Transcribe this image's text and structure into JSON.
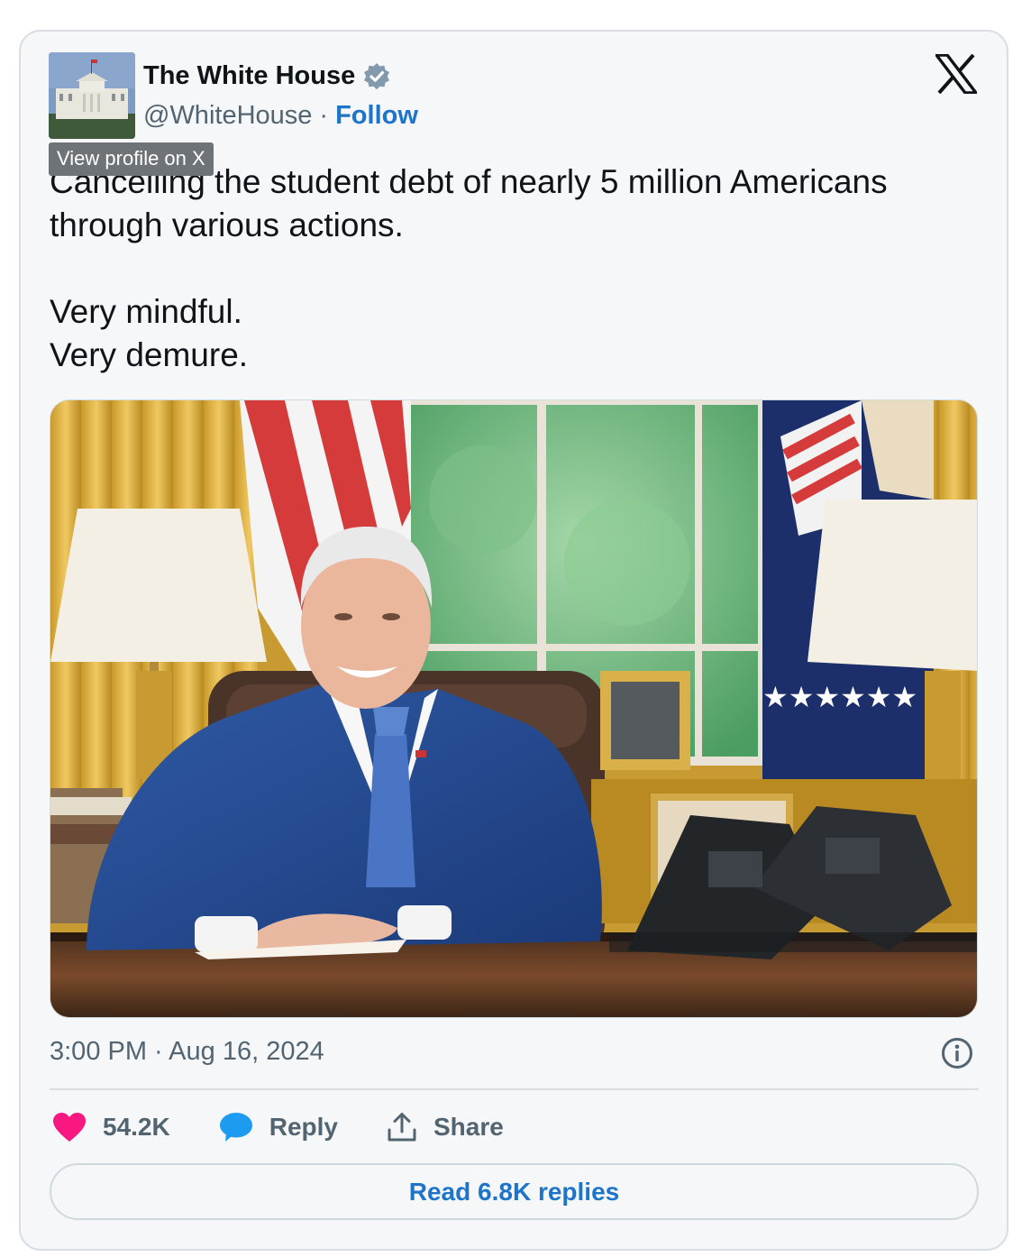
{
  "author": {
    "name": "The White House",
    "handle": "@WhiteHouse",
    "separator": "·",
    "follow_label": "Follow",
    "verified": true
  },
  "tooltip": "View profile on X",
  "tweet": {
    "text": "Cancelling the student debt of nearly 5 million Americans through various actions.\n\nVery mindful.\nVery demure.",
    "timestamp": "3:00 PM · Aug 16, 2024"
  },
  "engagement": {
    "likes": "54.2K",
    "reply_label": "Reply",
    "share_label": "Share",
    "read_replies_label": "Read 6.8K replies"
  },
  "icons": {
    "like": "heart-icon",
    "reply": "speech-bubble-icon",
    "share": "share-icon",
    "info": "info-icon",
    "brand": "x-logo-icon",
    "verified": "verified-badge-icon"
  },
  "colors": {
    "heart": "#f91880",
    "reply": "#1d9bf0",
    "link": "#1d74c9",
    "muted": "#536471"
  }
}
